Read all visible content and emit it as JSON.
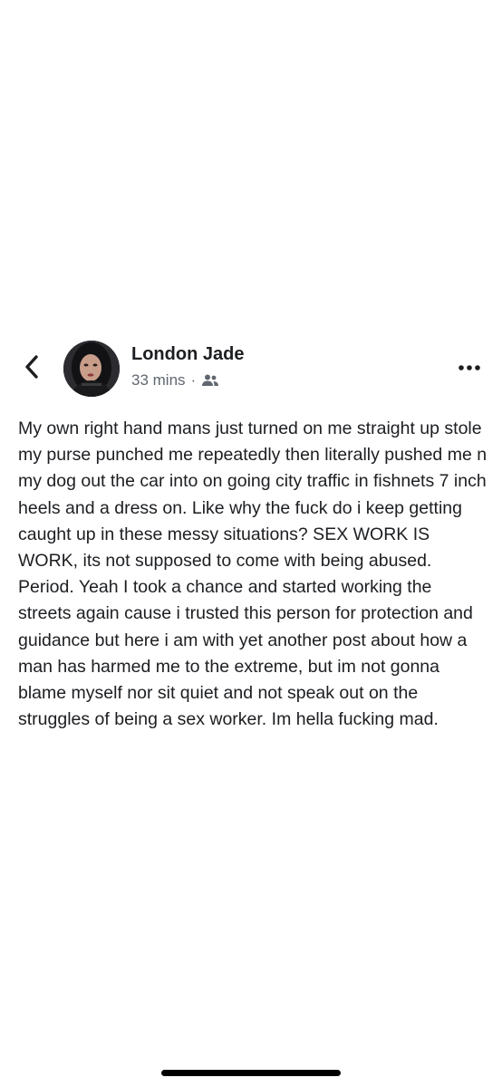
{
  "post": {
    "author_name": "London Jade",
    "timestamp": "33 mins",
    "separator": "·",
    "audience_icon": "friends-icon",
    "body": "My own right hand mans just turned on me straight up stole my purse punched me repeatedly then literally pushed me n my dog out the car into on going city traffic in fishnets 7 inch heels and a dress on. Like why the fuck do i keep getting caught up in these messy situations? SEX WORK IS WORK, its not supposed to come with being abused. Period. Yeah I took a chance and started working the streets again cause i trusted this person for protection and guidance but here i am with yet another post about how a man has harmed me to the extreme, but im not gonna blame myself nor sit quiet and not speak out on the struggles of being a sex worker. Im hella fucking mad."
  },
  "navigation": {
    "back_icon": "chevron-left-icon",
    "more_icon": "more-horizontal-icon"
  },
  "colors": {
    "text_primary": "#1c1e21",
    "text_secondary": "#606770",
    "background": "#ffffff"
  }
}
